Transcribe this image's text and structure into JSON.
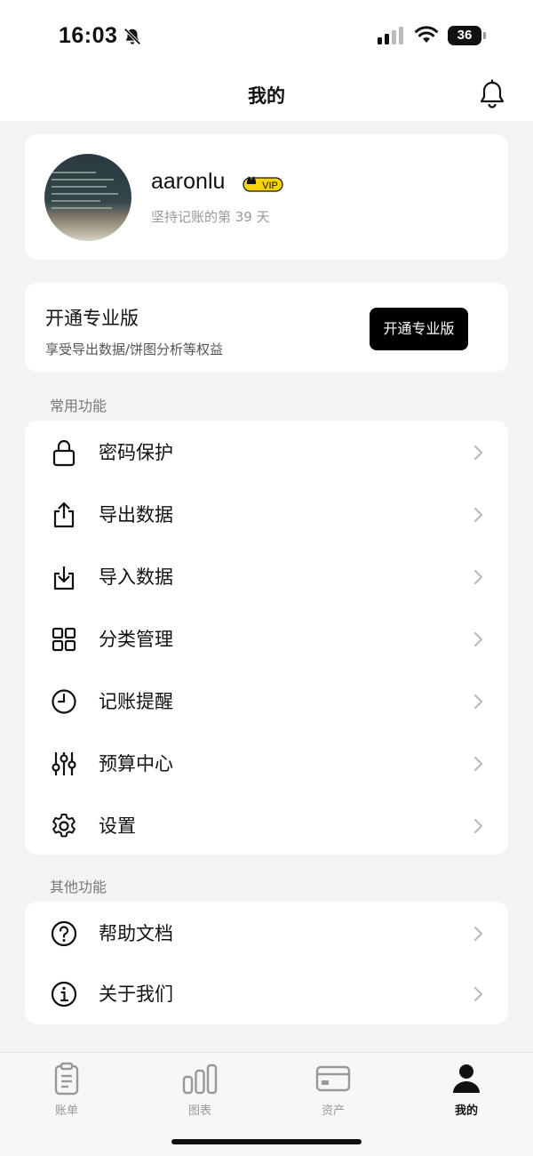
{
  "status": {
    "time": "16:03",
    "battery": "36"
  },
  "header": {
    "title": "我的"
  },
  "profile": {
    "username": "aaronlu",
    "vip_badge": "VIP",
    "days_text": "坚持记账的第 39 天"
  },
  "pro": {
    "title": "开通专业版",
    "subtitle": "享受导出数据/饼图分析等权益",
    "button_label": "开通专业版"
  },
  "common": {
    "section_title": "常用功能",
    "items": [
      {
        "label": "密码保护",
        "icon": "lock-icon"
      },
      {
        "label": "导出数据",
        "icon": "export-icon"
      },
      {
        "label": "导入数据",
        "icon": "import-icon"
      },
      {
        "label": "分类管理",
        "icon": "grid-icon"
      },
      {
        "label": "记账提醒",
        "icon": "clock-icon"
      },
      {
        "label": "预算中心",
        "icon": "sliders-icon"
      },
      {
        "label": "设置",
        "icon": "gear-icon"
      }
    ]
  },
  "other": {
    "section_title": "其他功能",
    "items": [
      {
        "label": "帮助文档",
        "icon": "help-icon"
      },
      {
        "label": "关于我们",
        "icon": "info-icon"
      }
    ]
  },
  "tabbar": {
    "items": [
      {
        "label": "账单",
        "icon": "bill-icon",
        "active": false
      },
      {
        "label": "图表",
        "icon": "chart-icon",
        "active": false
      },
      {
        "label": "资产",
        "icon": "card-icon",
        "active": false
      },
      {
        "label": "我的",
        "icon": "person-icon",
        "active": true
      }
    ]
  },
  "colors": {
    "accent": "#000000",
    "vip": "#f5d300",
    "background": "#f4f4f4",
    "muted": "#999999"
  }
}
